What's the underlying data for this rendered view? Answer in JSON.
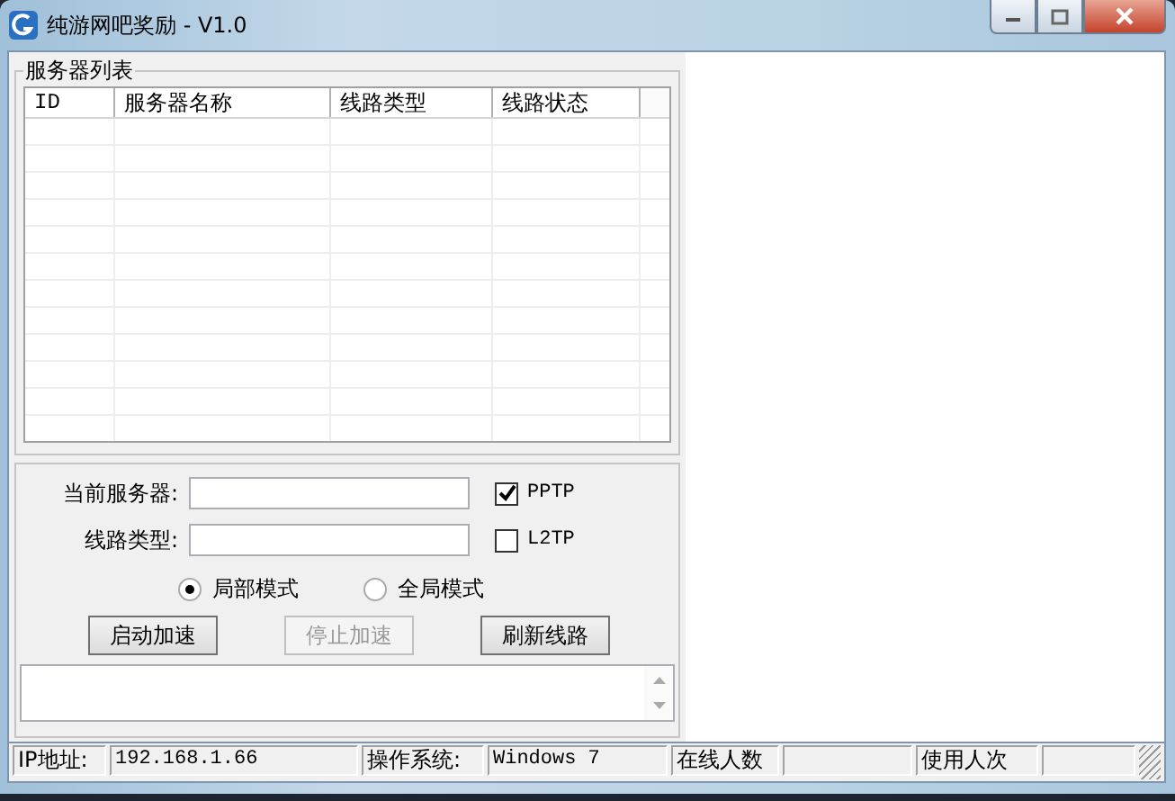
{
  "window": {
    "title": "纯游网吧奖励 - V1.0"
  },
  "server_list": {
    "title": "服务器列表",
    "columns": [
      "ID",
      "服务器名称",
      "线路类型",
      "线路状态"
    ]
  },
  "fields": [
    {
      "label": "当前服务器:"
    },
    {
      "label": "线路类型:"
    }
  ],
  "protocols": [
    {
      "label": "PPTP",
      "checked": true
    },
    {
      "label": "L2TP",
      "checked": false
    }
  ],
  "modes": [
    {
      "label": "局部模式",
      "selected": true
    },
    {
      "label": "全局模式",
      "selected": false
    }
  ],
  "buttons": [
    {
      "label": "启动加速",
      "disabled": false
    },
    {
      "label": "停止加速",
      "disabled": true
    },
    {
      "label": "刷新线路",
      "disabled": false
    }
  ],
  "status_bar": [
    {
      "kind": "label",
      "text": "IP地址:"
    },
    {
      "kind": "value",
      "text": "192.168.1.66"
    },
    {
      "kind": "label",
      "text": "操作系统:"
    },
    {
      "kind": "value",
      "text": "Windows 7"
    },
    {
      "kind": "label",
      "text": "在线人数"
    },
    {
      "kind": "value"
    },
    {
      "kind": "label",
      "text": "使用人次"
    },
    {
      "kind": "value"
    }
  ]
}
